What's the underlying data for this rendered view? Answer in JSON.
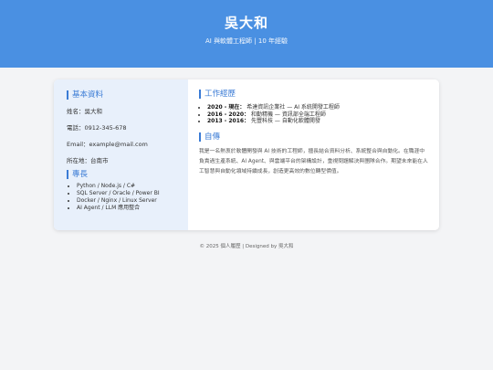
{
  "header": {
    "name": "吳大和",
    "subtitle": "AI 與軟體工程師 | 10 年經驗"
  },
  "basic": {
    "title": "基本資料",
    "name_line": "姓名：吳大和",
    "phone_line": "電話：0912-345-678",
    "email_line": "Email：example@mail.com",
    "location_line": "所在地：台南市"
  },
  "skills": {
    "title": "專長",
    "items": [
      "Python / Node.js / C#",
      "SQL Server / Oracle / Power BI",
      "Docker / Nginx / Linux Server",
      "AI Agent / LLM 應用整合"
    ]
  },
  "experience": {
    "title": "工作經歷",
    "items": [
      {
        "years": "2020 - 現在：",
        "desc": "希達資訊企業社 — AI 系統開發工程師"
      },
      {
        "years": "2016 - 2020：",
        "desc": "和勤精機 — 資訊部全端工程師"
      },
      {
        "years": "2013 - 2016：",
        "desc": "先豐科技 — 自動化軟體開發"
      }
    ]
  },
  "bio": {
    "title": "自傳",
    "text": "我是一名熱衷於軟體開發與 AI 技術的工程師，擅長結合資料分析、系統整合與自動化。在職涯中負責過生產系統、AI Agent、與雲端平台的架構設計，重視問題解決與團隊合作。期望未來能在人工智慧與自動化領域持續成長，創造更高效的數位轉型價值。"
  },
  "footer": {
    "text": "© 2025 個人履歷 | Designed by 吳大和"
  },
  "colors": {
    "header_bg": "#4a90e2",
    "accent": "#3a7bd5",
    "sidebar_bg": "#e8f0fb"
  }
}
